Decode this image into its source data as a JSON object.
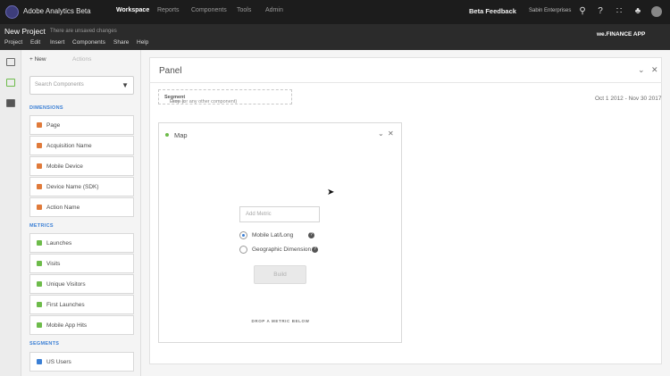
{
  "app": {
    "title": "Adobe Analytics Beta",
    "beta_feedback": "Beta Feedback",
    "company": "Sabin Enterprises"
  },
  "topnav": [
    "Workspace",
    "Reports",
    "Components",
    "Tools",
    "Admin"
  ],
  "project": {
    "title": "New Project",
    "status": "There are unsaved changes"
  },
  "menu": [
    "Project",
    "Edit",
    "Insert",
    "Components",
    "Share",
    "Help"
  ],
  "report_suite": "we.FINANCE APP",
  "left_panel": {
    "new_label": "+ New",
    "actions_label": "Actions",
    "search_placeholder": "Search Components",
    "dimensions_header": "DIMENSIONS",
    "dimensions": [
      "Page",
      "Acquisition Name",
      "Mobile Device",
      "Device Name (SDK)",
      "Action Name"
    ],
    "metrics_header": "METRICS",
    "metrics": [
      "Launches",
      "Visits",
      "Unique Visitors",
      "First Launches",
      "Mobile App Hits"
    ],
    "segments_header": "SEGMENTS",
    "segments": [
      "US Users"
    ]
  },
  "panel": {
    "title": "Panel",
    "drop_prefix": "Drop a ",
    "drop_bold": "Segment",
    "drop_suffix": " Here (or any other component)",
    "date_range": "Oct 1 2012 - Nov 30 2017"
  },
  "viz": {
    "title": "Map",
    "drop_label": "DROP A METRIC BELOW",
    "metric_placeholder": "Add Metric",
    "option_1": "Mobile Lat/Long",
    "option_2": "Geographic Dimension",
    "build_label": "Build"
  },
  "colors": {
    "topbar": "#1c1c1c",
    "accent": "#3a7fd5",
    "dimension": "#e07a3a",
    "metric": "#6dbb4a"
  }
}
